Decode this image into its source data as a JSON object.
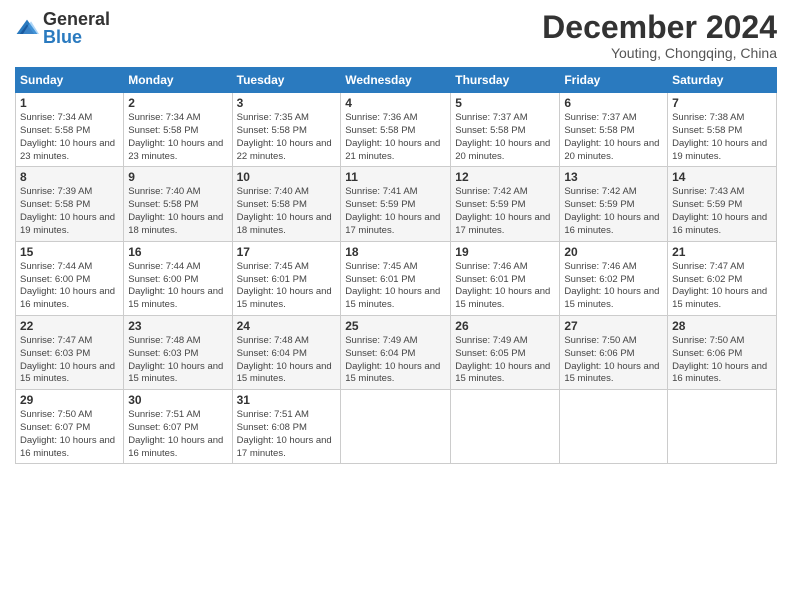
{
  "logo": {
    "general": "General",
    "blue": "Blue"
  },
  "header": {
    "month": "December 2024",
    "location": "Youting, Chongqing, China"
  },
  "weekdays": [
    "Sunday",
    "Monday",
    "Tuesday",
    "Wednesday",
    "Thursday",
    "Friday",
    "Saturday"
  ],
  "weeks": [
    [
      {
        "day": 1,
        "sunrise": "7:34 AM",
        "sunset": "5:58 PM",
        "daylight": "10 hours and 23 minutes."
      },
      {
        "day": 2,
        "sunrise": "7:34 AM",
        "sunset": "5:58 PM",
        "daylight": "10 hours and 23 minutes."
      },
      {
        "day": 3,
        "sunrise": "7:35 AM",
        "sunset": "5:58 PM",
        "daylight": "10 hours and 22 minutes."
      },
      {
        "day": 4,
        "sunrise": "7:36 AM",
        "sunset": "5:58 PM",
        "daylight": "10 hours and 21 minutes."
      },
      {
        "day": 5,
        "sunrise": "7:37 AM",
        "sunset": "5:58 PM",
        "daylight": "10 hours and 20 minutes."
      },
      {
        "day": 6,
        "sunrise": "7:37 AM",
        "sunset": "5:58 PM",
        "daylight": "10 hours and 20 minutes."
      },
      {
        "day": 7,
        "sunrise": "7:38 AM",
        "sunset": "5:58 PM",
        "daylight": "10 hours and 19 minutes."
      }
    ],
    [
      {
        "day": 8,
        "sunrise": "7:39 AM",
        "sunset": "5:58 PM",
        "daylight": "10 hours and 19 minutes."
      },
      {
        "day": 9,
        "sunrise": "7:40 AM",
        "sunset": "5:58 PM",
        "daylight": "10 hours and 18 minutes."
      },
      {
        "day": 10,
        "sunrise": "7:40 AM",
        "sunset": "5:58 PM",
        "daylight": "10 hours and 18 minutes."
      },
      {
        "day": 11,
        "sunrise": "7:41 AM",
        "sunset": "5:59 PM",
        "daylight": "10 hours and 17 minutes."
      },
      {
        "day": 12,
        "sunrise": "7:42 AM",
        "sunset": "5:59 PM",
        "daylight": "10 hours and 17 minutes."
      },
      {
        "day": 13,
        "sunrise": "7:42 AM",
        "sunset": "5:59 PM",
        "daylight": "10 hours and 16 minutes."
      },
      {
        "day": 14,
        "sunrise": "7:43 AM",
        "sunset": "5:59 PM",
        "daylight": "10 hours and 16 minutes."
      }
    ],
    [
      {
        "day": 15,
        "sunrise": "7:44 AM",
        "sunset": "6:00 PM",
        "daylight": "10 hours and 16 minutes."
      },
      {
        "day": 16,
        "sunrise": "7:44 AM",
        "sunset": "6:00 PM",
        "daylight": "10 hours and 15 minutes."
      },
      {
        "day": 17,
        "sunrise": "7:45 AM",
        "sunset": "6:01 PM",
        "daylight": "10 hours and 15 minutes."
      },
      {
        "day": 18,
        "sunrise": "7:45 AM",
        "sunset": "6:01 PM",
        "daylight": "10 hours and 15 minutes."
      },
      {
        "day": 19,
        "sunrise": "7:46 AM",
        "sunset": "6:01 PM",
        "daylight": "10 hours and 15 minutes."
      },
      {
        "day": 20,
        "sunrise": "7:46 AM",
        "sunset": "6:02 PM",
        "daylight": "10 hours and 15 minutes."
      },
      {
        "day": 21,
        "sunrise": "7:47 AM",
        "sunset": "6:02 PM",
        "daylight": "10 hours and 15 minutes."
      }
    ],
    [
      {
        "day": 22,
        "sunrise": "7:47 AM",
        "sunset": "6:03 PM",
        "daylight": "10 hours and 15 minutes."
      },
      {
        "day": 23,
        "sunrise": "7:48 AM",
        "sunset": "6:03 PM",
        "daylight": "10 hours and 15 minutes."
      },
      {
        "day": 24,
        "sunrise": "7:48 AM",
        "sunset": "6:04 PM",
        "daylight": "10 hours and 15 minutes."
      },
      {
        "day": 25,
        "sunrise": "7:49 AM",
        "sunset": "6:04 PM",
        "daylight": "10 hours and 15 minutes."
      },
      {
        "day": 26,
        "sunrise": "7:49 AM",
        "sunset": "6:05 PM",
        "daylight": "10 hours and 15 minutes."
      },
      {
        "day": 27,
        "sunrise": "7:50 AM",
        "sunset": "6:06 PM",
        "daylight": "10 hours and 15 minutes."
      },
      {
        "day": 28,
        "sunrise": "7:50 AM",
        "sunset": "6:06 PM",
        "daylight": "10 hours and 16 minutes."
      }
    ],
    [
      {
        "day": 29,
        "sunrise": "7:50 AM",
        "sunset": "6:07 PM",
        "daylight": "10 hours and 16 minutes."
      },
      {
        "day": 30,
        "sunrise": "7:51 AM",
        "sunset": "6:07 PM",
        "daylight": "10 hours and 16 minutes."
      },
      {
        "day": 31,
        "sunrise": "7:51 AM",
        "sunset": "6:08 PM",
        "daylight": "10 hours and 17 minutes."
      },
      null,
      null,
      null,
      null
    ]
  ]
}
